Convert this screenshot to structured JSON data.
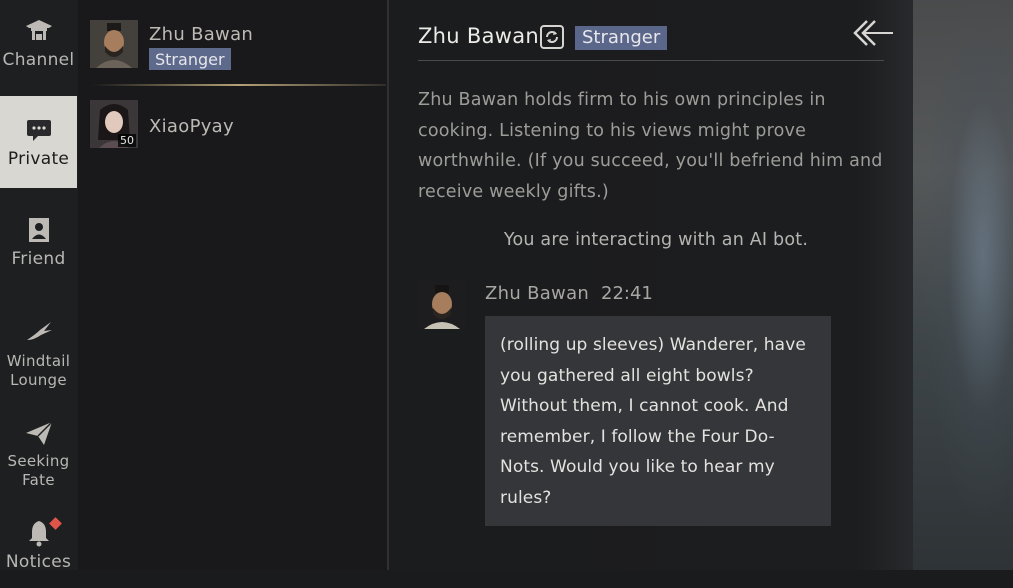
{
  "nav": {
    "items": [
      {
        "label": "Channel",
        "icon": "pagoda-icon"
      },
      {
        "label": "Private",
        "icon": "speech-bubble-icon"
      },
      {
        "label": "Friend",
        "icon": "friend-card-icon"
      },
      {
        "label": "Windtail Lounge",
        "icon": "swallow-icon"
      },
      {
        "label": "Seeking Fate",
        "icon": "paper-plane-icon"
      },
      {
        "label": "Notices",
        "icon": "bell-icon"
      }
    ],
    "active": "Private"
  },
  "contacts": [
    {
      "name": "Zhu Bawan",
      "tag": "Stranger"
    },
    {
      "name": "XiaoPyay",
      "level": "50"
    }
  ],
  "chat": {
    "title": "Zhu Bawan",
    "tag": "Stranger",
    "intro": "Zhu Bawan holds firm to his own principles in cooking. Listening to his views might prove worthwhile. (If you succeed, you'll befriend him and receive weekly gifts.)",
    "ai_note": "You are interacting with an AI bot.",
    "messages": [
      {
        "sender": "Zhu Bawan",
        "time": "22:41",
        "text": "(rolling up sleeves) Wanderer, have you gathered all eight bowls? Without them, I cannot cook. And remember, I follow the Four Do-Nots. Would you like to hear my rules?"
      }
    ]
  },
  "colors": {
    "tag_bg": "#5b678a",
    "active_nav_bg": "#d9d7d2",
    "bubble_bg": "#34363a",
    "notice_badge": "#e0554a"
  }
}
